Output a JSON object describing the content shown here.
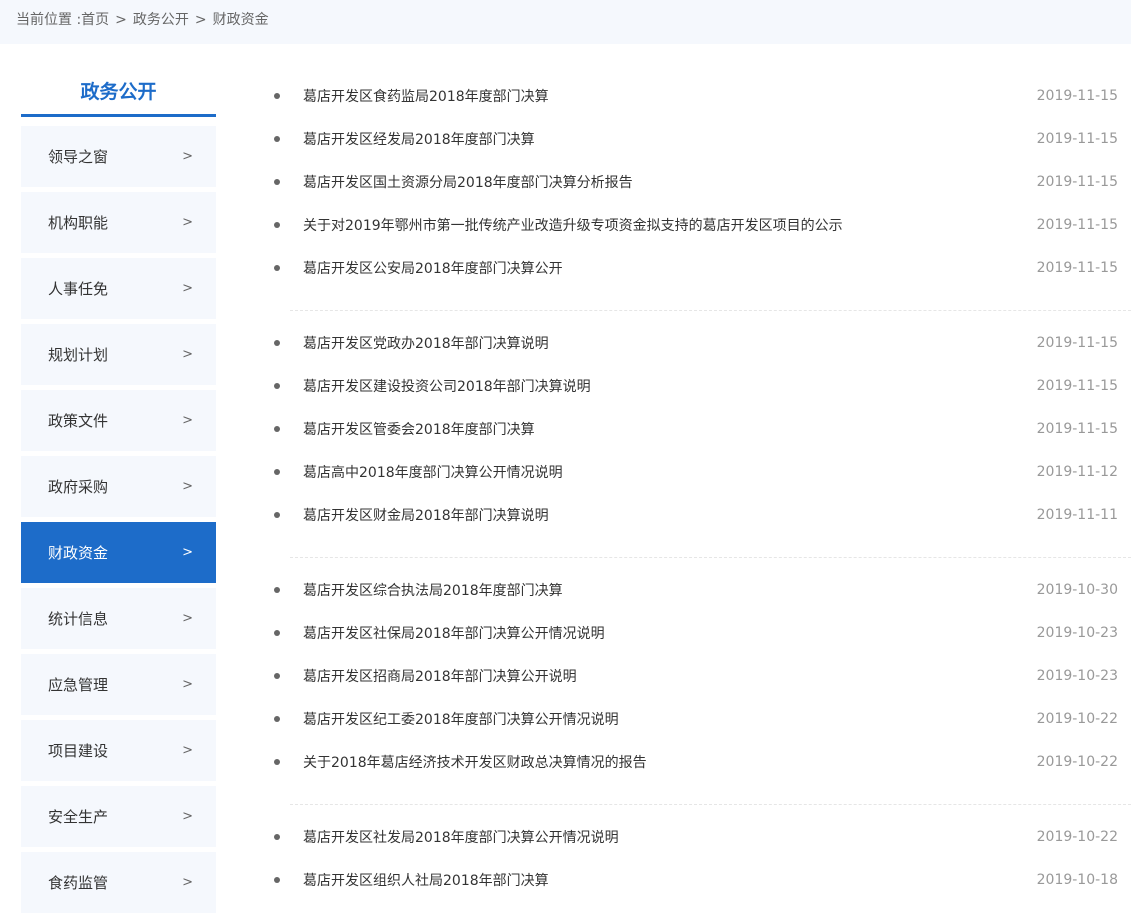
{
  "breadcrumb": {
    "prefix": "当前位置 :",
    "items": [
      "首页",
      "政务公开",
      "财政资金"
    ],
    "separator": ">"
  },
  "sidebar": {
    "title": "政务公开",
    "arrow": ">",
    "items": [
      {
        "label": "领导之窗",
        "active": false
      },
      {
        "label": "机构职能",
        "active": false
      },
      {
        "label": "人事任免",
        "active": false
      },
      {
        "label": "规划计划",
        "active": false
      },
      {
        "label": "政策文件",
        "active": false
      },
      {
        "label": "政府采购",
        "active": false
      },
      {
        "label": "财政资金",
        "active": true
      },
      {
        "label": "统计信息",
        "active": false
      },
      {
        "label": "应急管理",
        "active": false
      },
      {
        "label": "项目建设",
        "active": false
      },
      {
        "label": "安全生产",
        "active": false
      },
      {
        "label": "食药监管",
        "active": false
      }
    ]
  },
  "news": {
    "groups": [
      [
        {
          "title": "葛店开发区食药监局2018年度部门决算",
          "date": "2019-11-15"
        },
        {
          "title": "葛店开发区经发局2018年度部门决算",
          "date": "2019-11-15"
        },
        {
          "title": "葛店开发区国土资源分局2018年度部门决算分析报告",
          "date": "2019-11-15"
        },
        {
          "title": "关于对2019年鄂州市第一批传统产业改造升级专项资金拟支持的葛店开发区项目的公示",
          "date": "2019-11-15"
        },
        {
          "title": "葛店开发区公安局2018年度部门决算公开",
          "date": "2019-11-15"
        }
      ],
      [
        {
          "title": "葛店开发区党政办2018年部门决算说明",
          "date": "2019-11-15"
        },
        {
          "title": "葛店开发区建设投资公司2018年部门决算说明",
          "date": "2019-11-15"
        },
        {
          "title": "葛店开发区管委会2018年度部门决算",
          "date": "2019-11-15"
        },
        {
          "title": "葛店高中2018年度部门决算公开情况说明",
          "date": "2019-11-12"
        },
        {
          "title": "葛店开发区财金局2018年部门决算说明",
          "date": "2019-11-11"
        }
      ],
      [
        {
          "title": "葛店开发区综合执法局2018年度部门决算",
          "date": "2019-10-30"
        },
        {
          "title": "葛店开发区社保局2018年部门决算公开情况说明",
          "date": "2019-10-23"
        },
        {
          "title": "葛店开发区招商局2018年部门决算公开说明",
          "date": "2019-10-23"
        },
        {
          "title": "葛店开发区纪工委2018年度部门决算公开情况说明",
          "date": "2019-10-22"
        },
        {
          "title": "关于2018年葛店经济技术开发区财政总决算情况的报告",
          "date": "2019-10-22"
        }
      ],
      [
        {
          "title": "葛店开发区社发局2018年度部门决算公开情况说明",
          "date": "2019-10-22"
        },
        {
          "title": "葛店开发区组织人社局2018年部门决算",
          "date": "2019-10-18"
        }
      ]
    ]
  },
  "colors": {
    "accent": "#1d6cc9",
    "panel_bg": "#f5f8fd",
    "date": "#999999"
  }
}
